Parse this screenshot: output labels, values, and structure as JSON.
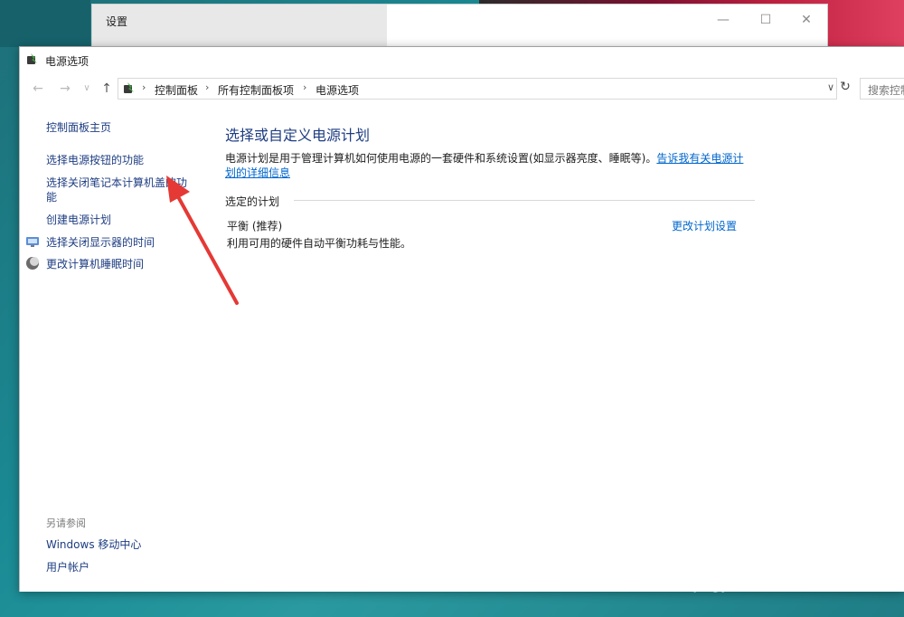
{
  "settings_window": {
    "title": "设置",
    "minimize": "—",
    "maximize": "☐",
    "close": "✕"
  },
  "window": {
    "title": "电源选项",
    "icon": "power-options-icon"
  },
  "address_bar": {
    "back": "←",
    "forward": "→",
    "recent": "∨",
    "up": "↑",
    "breadcrumbs": [
      "控制面板",
      "所有控制面板项",
      "电源选项"
    ],
    "separator": "›",
    "dropdown": "∨",
    "refresh": "↻",
    "search_placeholder": "搜索控制"
  },
  "left_pane": {
    "home": "控制面板主页",
    "links": [
      "选择电源按钮的功能",
      "选择关闭笔记本计算机盖的功",
      "能",
      "创建电源计划",
      "选择关闭显示器的时间",
      "更改计算机睡眠时间"
    ],
    "see_also_label": "另请参阅",
    "see_also": [
      "Windows 移动中心",
      "用户帐户"
    ]
  },
  "content": {
    "title": "选择或自定义电源计划",
    "description": "电源计划是用于管理计算机如何使用电源的一套硬件和系统设置(如显示器亮度、睡眠等)。",
    "description_link_1": "告诉我有关电源计",
    "description_link_2": "划的详细信息",
    "section_label": "选定的计划",
    "plan_name": "平衡 (推荐)",
    "plan_description": "利用可用的硬件自动平衡功耗与性能。",
    "change_plan": "更改计划设置"
  },
  "watermark": {
    "text": "Bai du 经验",
    "sub": "jingyan.baidu.com"
  },
  "colors": {
    "link": "#0066cc",
    "nav_link": "#1e3d82",
    "arrow": "#e53935"
  }
}
